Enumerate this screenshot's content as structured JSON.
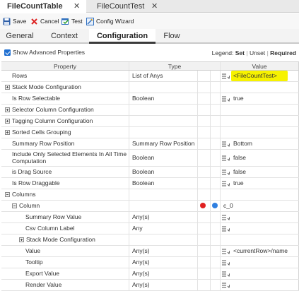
{
  "doc_tabs": [
    {
      "label": "FileCountTable",
      "active": true
    },
    {
      "label": "FileCountTest",
      "active": false
    }
  ],
  "toolbar": {
    "save": "Save",
    "cancel": "Cancel",
    "test": "Test",
    "config_wizard": "Config Wizard"
  },
  "section_tabs": [
    "General",
    "Context",
    "Configuration",
    "Flow"
  ],
  "options": {
    "show_advanced": "Show Advanced Properties",
    "legend_prefix": "Legend:",
    "legend_set": "Set",
    "legend_sep": "|",
    "legend_unset": "Unset",
    "legend_required": "Required"
  },
  "grid": {
    "headers": {
      "property": "Property",
      "type": "Type",
      "value": "Value"
    },
    "rows": [
      {
        "label": "Rows",
        "type": "List of Anys",
        "value": "<FileCountTest>"
      },
      {
        "label": "Stack Mode Configuration",
        "type": "",
        "value": ""
      },
      {
        "label": "Is Row Selectable",
        "type": "Boolean",
        "value": "true"
      },
      {
        "label": "Selector Column Configuration",
        "type": "",
        "value": ""
      },
      {
        "label": "Tagging Column Configuration",
        "type": "",
        "value": ""
      },
      {
        "label": "Sorted Cells Grouping",
        "type": "",
        "value": ""
      },
      {
        "label": "Summary Row Position",
        "type": "Summary Row Position",
        "value": "Bottom"
      },
      {
        "label": "Include Only Selected Elements In All Time Computation",
        "type": "Boolean",
        "value": "false"
      },
      {
        "label": "is Drag Source",
        "type": "Boolean",
        "value": "false"
      },
      {
        "label": "Is Row Draggable",
        "type": "Boolean",
        "value": "true"
      },
      {
        "label": "Columns",
        "type": "",
        "value": ""
      },
      {
        "label": "Column",
        "type": "",
        "value": "c_0"
      },
      {
        "label": "Summary Row Value",
        "type": "Any(s)",
        "value": ""
      },
      {
        "label": "Csv Column Label",
        "type": "Any",
        "value": ""
      },
      {
        "label": "Stack Mode Configuration",
        "type": "",
        "value": ""
      },
      {
        "label": "Value",
        "type": "Any(s)",
        "value": "<currentRow>/name"
      },
      {
        "label": "Tooltip",
        "type": "Any(s)",
        "value": ""
      },
      {
        "label": "Export Value",
        "type": "Any(s)",
        "value": ""
      },
      {
        "label": "Render Value",
        "type": "Any(s)",
        "value": ""
      }
    ]
  },
  "colors": {
    "accent_blue": "#1f6fd1",
    "highlight_yellow": "#f7f200",
    "remove_red": "#e02020",
    "move_blue": "#2f7fe0"
  }
}
